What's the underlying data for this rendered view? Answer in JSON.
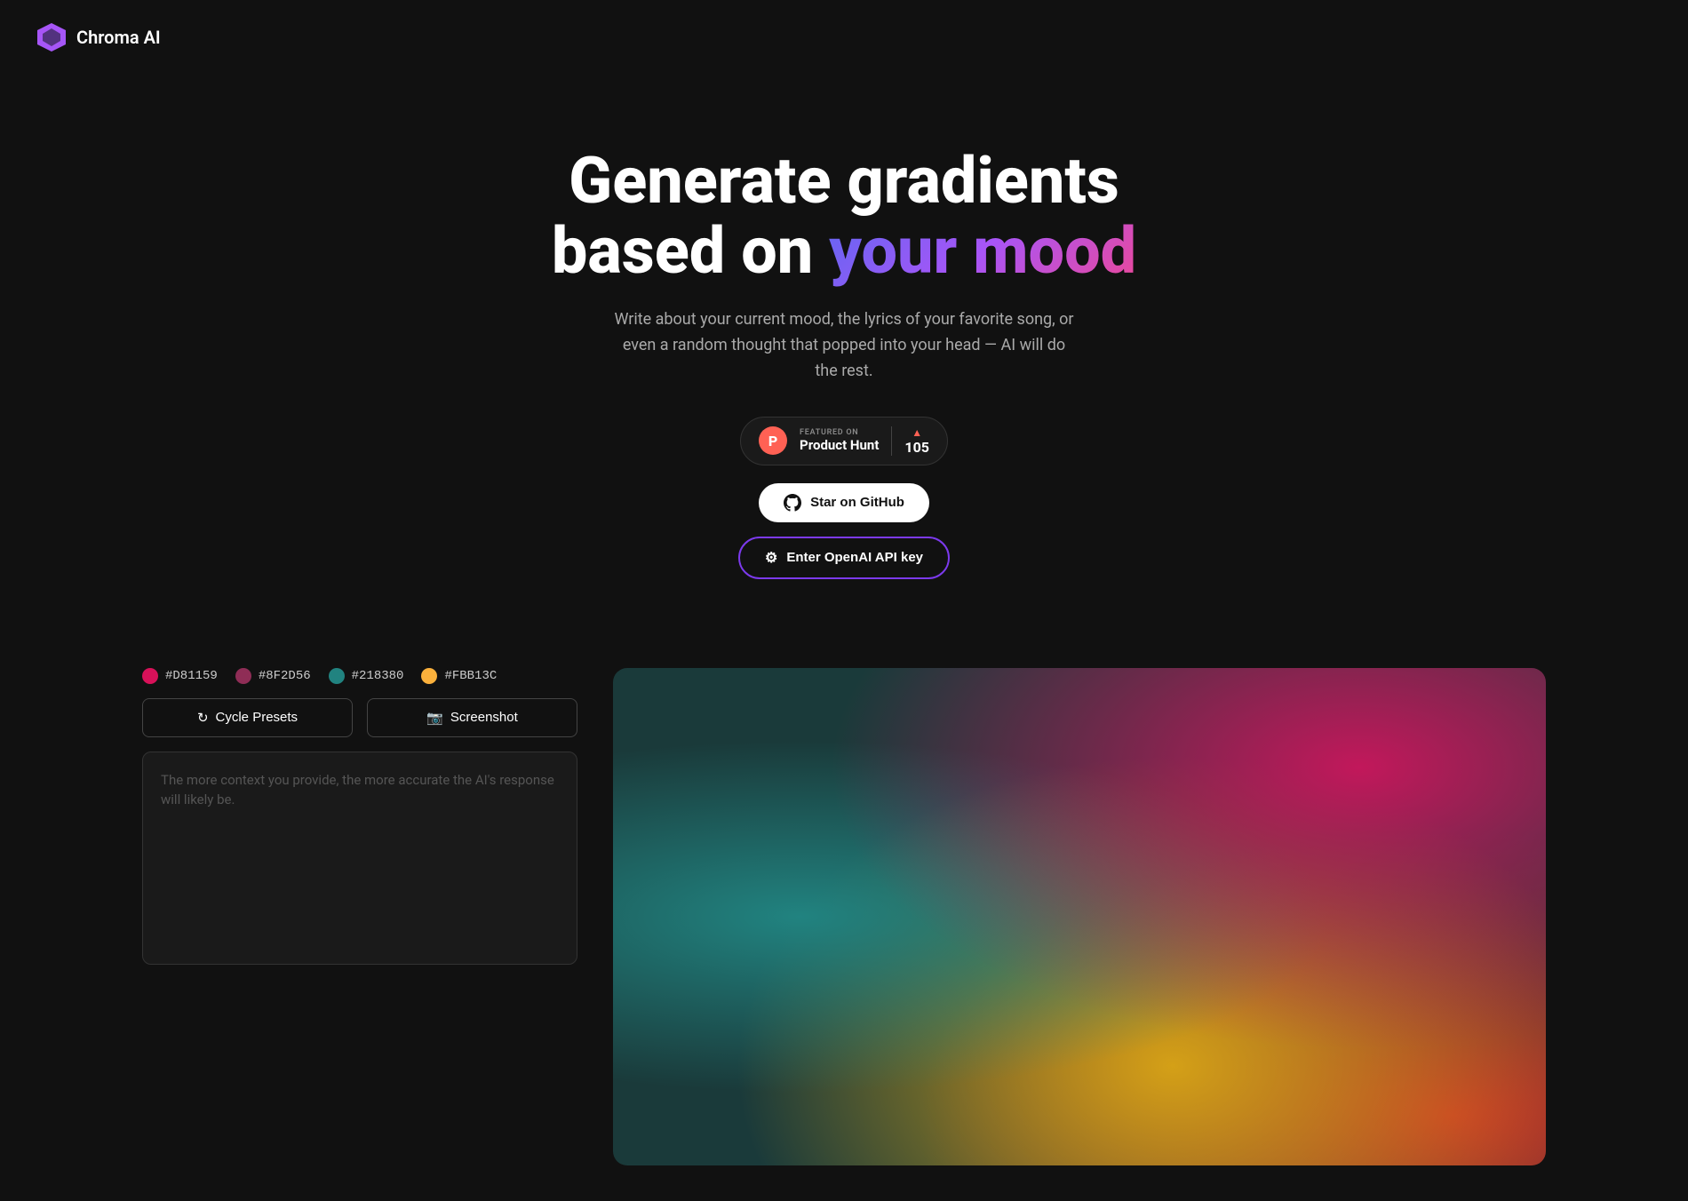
{
  "header": {
    "logo_text": "Chroma AI",
    "logo_icon_alt": "chroma-logo"
  },
  "hero": {
    "title_part1": "Generate gradients",
    "title_part2": "based on",
    "title_highlight": "your mood",
    "subtitle": "Write about your current mood, the lyrics of your favorite song, or even a random thought that popped into your head — AI will do the rest.",
    "product_hunt": {
      "featured_label": "FEATURED ON",
      "name": "Product Hunt",
      "score": "105"
    },
    "github_btn_label": "Star on GitHub",
    "api_key_btn_label": "Enter OpenAI API key"
  },
  "colors": [
    {
      "hex": "#D81159",
      "dot_color": "#D81159"
    },
    {
      "hex": "#8F2D56",
      "dot_color": "#8F2D56"
    },
    {
      "hex": "#218380",
      "dot_color": "#218380"
    },
    {
      "hex": "#FBB13C",
      "dot_color": "#FBB13C"
    }
  ],
  "buttons": {
    "cycle_presets": "Cycle Presets",
    "screenshot": "Screenshot"
  },
  "textarea": {
    "placeholder": "The more context you provide, the more accurate the AI's response will likely be."
  },
  "gradient": {
    "colors": [
      "#c2185b",
      "#80cbc4",
      "#d4a017",
      "#c62828"
    ]
  }
}
